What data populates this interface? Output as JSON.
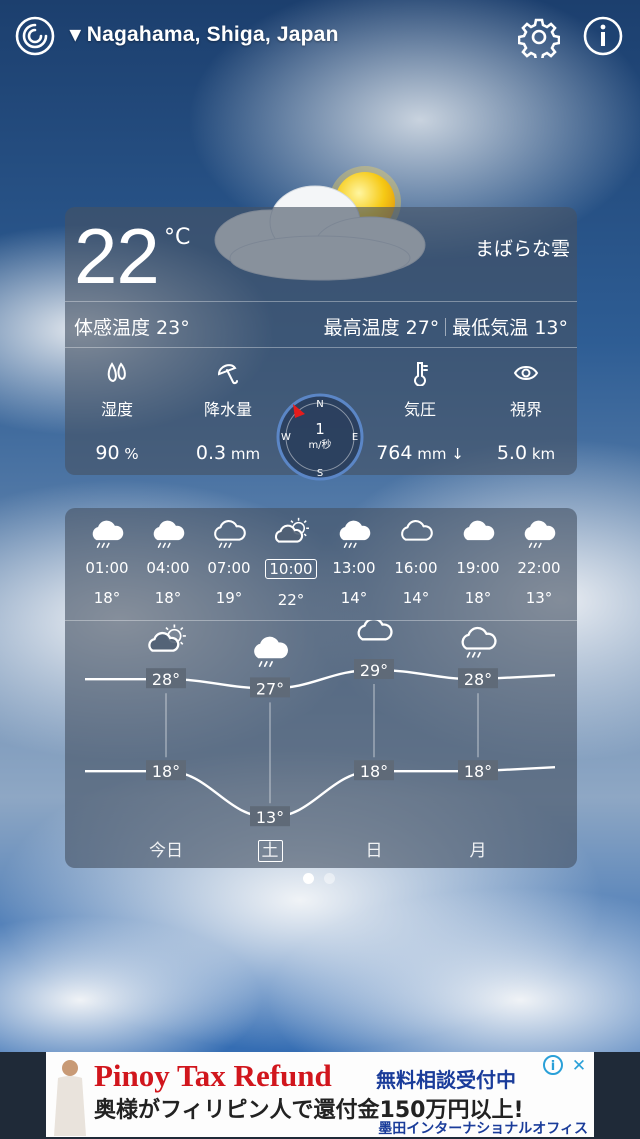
{
  "header": {
    "location": "▾ Nagahama, Shiga, Japan"
  },
  "current": {
    "temperature": "22",
    "unit": "°C",
    "condition": "まばらな雲",
    "feels_like": "体感温度 23°",
    "high": "最高温度 27°",
    "low": "最低気温 13°"
  },
  "stats": [
    {
      "icon": "humidity-icon",
      "label": "湿度",
      "value": "90",
      "unit": " %"
    },
    {
      "icon": "umbrella-icon",
      "label": "降水量",
      "value": "0.3",
      "unit": " mm"
    },
    {
      "icon": "thermometer-icon",
      "label": "気圧",
      "value": "764",
      "unit": " mm ↓"
    },
    {
      "icon": "eye-icon",
      "label": "視界",
      "value": "5.0",
      "unit": " km"
    }
  ],
  "wind": {
    "speed": "1",
    "unit": "m/秒",
    "n": "N",
    "e": "E",
    "s": "S",
    "w": "W"
  },
  "hourly": [
    {
      "time": "01:00",
      "temp": "18°",
      "icon": "rain-cloud-icon"
    },
    {
      "time": "04:00",
      "temp": "18°",
      "icon": "rain-cloud-icon"
    },
    {
      "time": "07:00",
      "temp": "19°",
      "icon": "drizzle-cloud-icon"
    },
    {
      "time": "10:00",
      "temp": "22°",
      "icon": "partly-sunny-icon"
    },
    {
      "time": "13:00",
      "temp": "14°",
      "icon": "rain-cloud-icon"
    },
    {
      "time": "16:00",
      "temp": "14°",
      "icon": "cloud-icon"
    },
    {
      "time": "19:00",
      "temp": "18°",
      "icon": "cloudy-icon"
    },
    {
      "time": "22:00",
      "temp": "13°",
      "icon": "rain-cloud-icon"
    }
  ],
  "daily": [
    {
      "day": "今日",
      "high": "28°",
      "low": "18°",
      "icon": "partly-sunny-icon"
    },
    {
      "day": "土",
      "high": "27°",
      "low": "13°",
      "icon": "rain-cloud-icon"
    },
    {
      "day": "日",
      "high": "29°",
      "low": "18°",
      "icon": "cloud-icon"
    },
    {
      "day": "月",
      "high": "28°",
      "low": "18°",
      "icon": "drizzle-cloud-icon"
    }
  ],
  "pager": {
    "count": 2,
    "active": 0
  },
  "ad": {
    "headline": "Pinoy Tax Refund",
    "tag": "無料相談受付中",
    "body": "奥様がフィリピン人で還付金150万円以上!",
    "footer": "墨田インターナショナルオフィス",
    "info": "i",
    "close": "✕"
  }
}
